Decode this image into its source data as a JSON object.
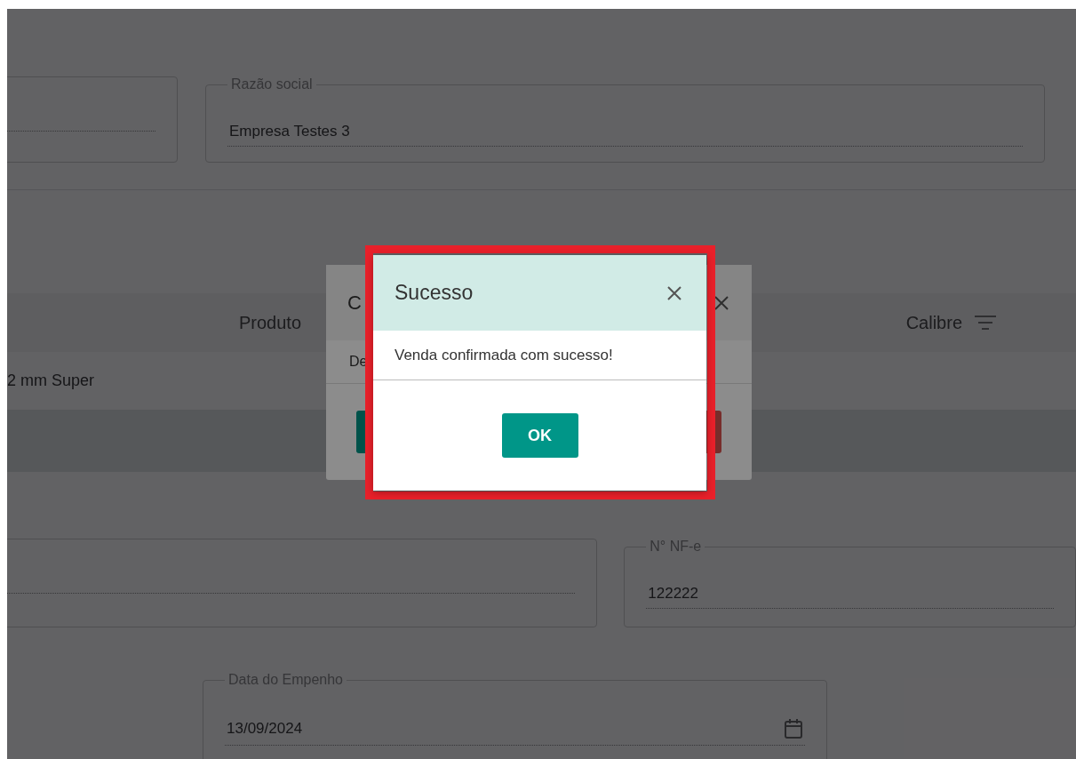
{
  "form_top": {
    "company_name": {
      "label": "Razão social",
      "value": "Empresa Testes 3"
    }
  },
  "table": {
    "columns": [
      "Produto",
      "Calibre"
    ],
    "rows": [
      {
        "cells": [
          "2 mm Super"
        ]
      }
    ]
  },
  "form_bottom": {
    "invoice_number": {
      "label": "N° NF-e",
      "value": "122222"
    },
    "commitment_date": {
      "label": "Data do Empenho",
      "value": "13/09/2024"
    }
  },
  "back_dialog": {
    "title": "C",
    "body_text": "De"
  },
  "success_dialog": {
    "title": "Sucesso",
    "message": "Venda confirmada com sucesso!",
    "ok_button": "OK"
  }
}
